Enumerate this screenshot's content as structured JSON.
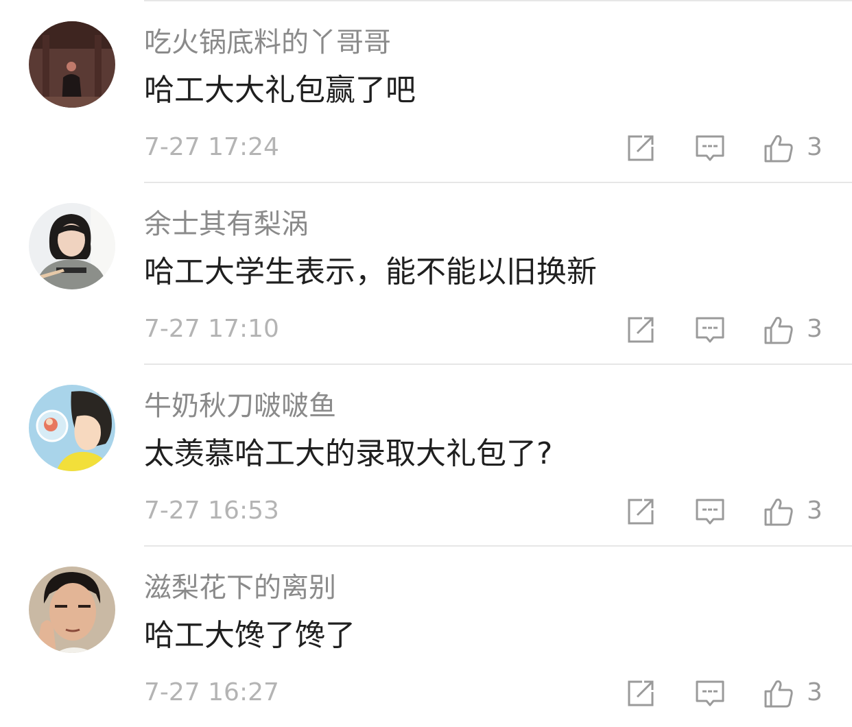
{
  "comments": [
    {
      "username": "吃火锅底料的丫哥哥",
      "text": "哈工大大礼包赢了吧",
      "time": "7-27 17:24",
      "likes": "3"
    },
    {
      "username": "余士其有梨涡",
      "text": "哈工大学生表示，能不能以旧换新",
      "time": "7-27 17:10",
      "likes": "3"
    },
    {
      "username": "牛奶秋刀啵啵鱼",
      "text": "太羡慕哈工大的录取大礼包了?",
      "time": "7-27 16:53",
      "likes": "3"
    },
    {
      "username": "滋梨花下的离别",
      "text": "哈工大馋了馋了",
      "time": "7-27 16:27",
      "likes": "3"
    }
  ],
  "icons": {
    "share": "share-icon",
    "reply": "reply-icon",
    "like": "thumbs-up-icon"
  },
  "colors": {
    "username": "#8a8a8a",
    "text": "#1f1f1f",
    "time": "#b4b4b4",
    "icon": "#9a9a9a",
    "divider": "#e6e6e6"
  }
}
